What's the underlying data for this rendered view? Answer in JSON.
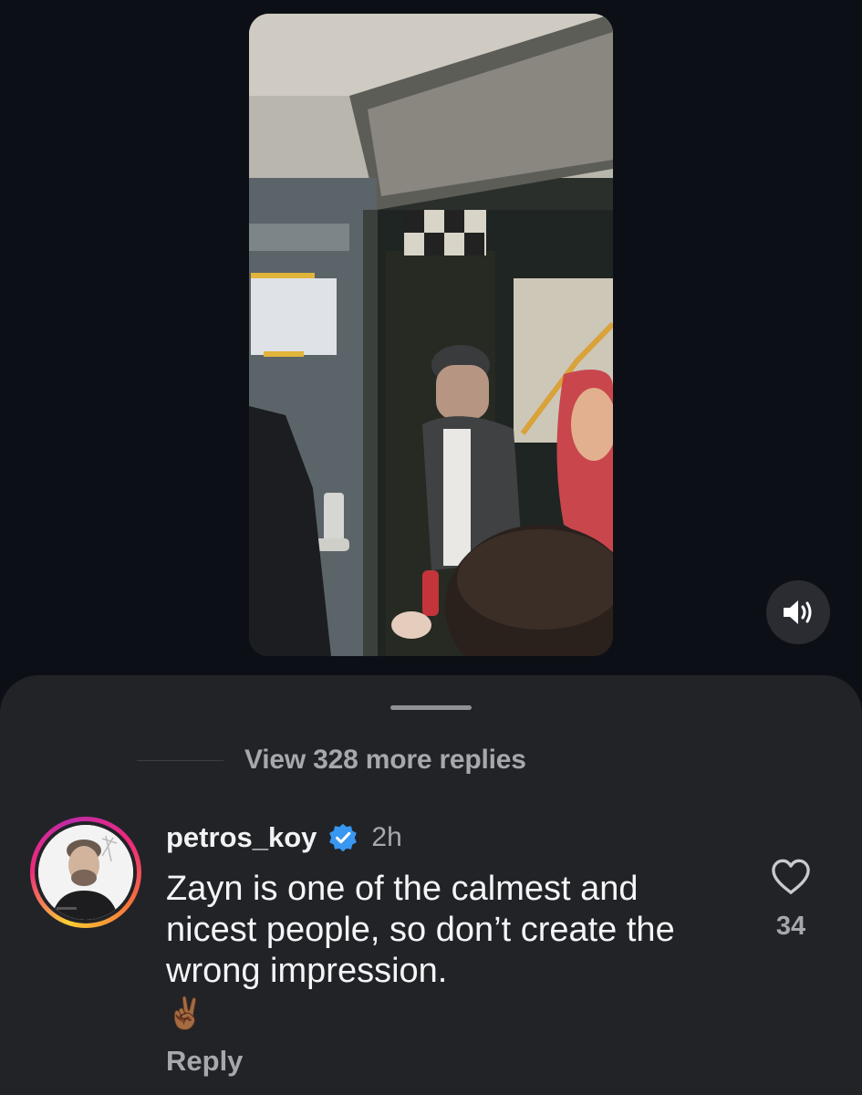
{
  "comments": {
    "view_more_replies": "View 328 more replies",
    "items": [
      {
        "username": "petros_koy",
        "verified": true,
        "time": "2h",
        "text": "Zayn is one of the calmest and nicest people, so don’t create the wrong impression.",
        "emoji": "✌🏾",
        "reply_label": "Reply",
        "like_count": "34"
      }
    ]
  },
  "colors": {
    "background": "#0c1016",
    "sheet": "#222327",
    "verified_badge": "#3897f0",
    "secondary_text": "#a6a8ad"
  },
  "icons": {
    "mute": "speaker-icon",
    "like": "heart-icon",
    "verified": "verified-badge-icon"
  }
}
